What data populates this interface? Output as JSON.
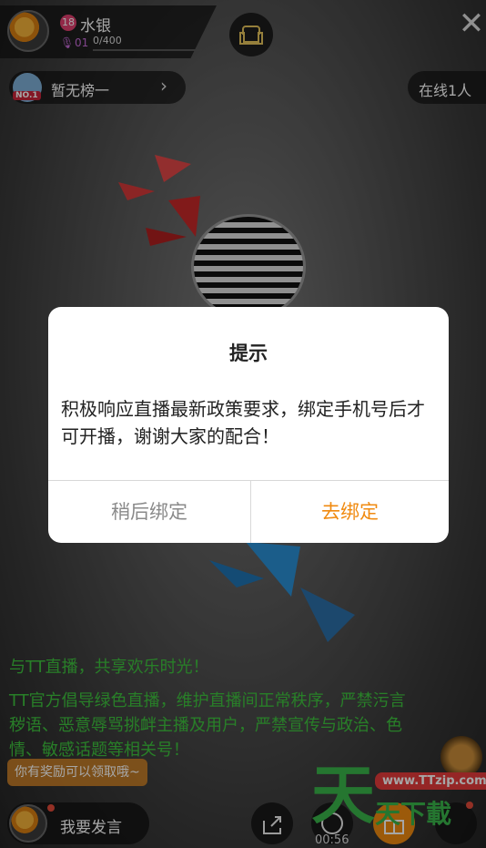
{
  "header": {
    "anchor_name": "水银",
    "level": "18",
    "fan_level": "01",
    "exp_text": "0/400",
    "exp_fraction": 0.0
  },
  "rank": {
    "label": "暂无榜一",
    "badge": "NO.1"
  },
  "online": {
    "label": "在线1人"
  },
  "dialog": {
    "title": "提示",
    "message": "积极响应直播最新政策要求，绑定手机号后才可开播，谢谢大家的配合！",
    "cancel_label": "稍后绑定",
    "confirm_label": "去绑定"
  },
  "chat": {
    "welcome": "与TT直播，共享欢乐时光！",
    "notice": "TT官方倡导绿色直播，维护直播间正常秩序，严禁污言秽语、恶意辱骂挑衅主播及用户，严禁宣传与政治、色情、敏感话题等相关号！"
  },
  "reward_tip": "你有奖励可以领取哦~",
  "bottom": {
    "speak_label": "我要发言",
    "timer": "00:56"
  },
  "watermark": {
    "char": "天",
    "url": "www.TTzip.com",
    "sub": "天下載"
  },
  "colors": {
    "accent": "#f08a10",
    "chat_green": "#3ec43e",
    "cancel_gray": "#8a8a8a"
  },
  "icons": [
    "sofa-icon",
    "close-icon",
    "chevron-right-icon",
    "share-icon",
    "record-icon",
    "gift-icon",
    "microphone-icon"
  ]
}
